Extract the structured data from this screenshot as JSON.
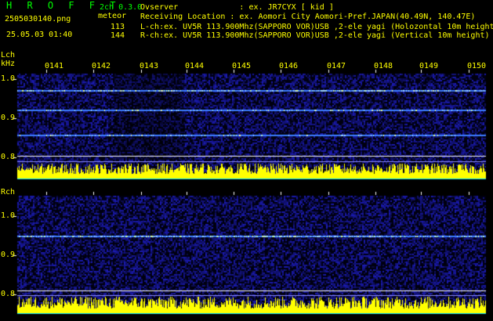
{
  "header": {
    "app_logo": "H R O F F T",
    "channel_mode": "2ch 0.3.0",
    "file_name": "2505030140.png",
    "datetime": "25.05.03 01:40",
    "meteor_label": "meteor",
    "lch_count": "113",
    "rch_count": "144",
    "observer_line": "Ovserver             : ex. JR7CYX [ kid ]",
    "location_line": "Receiving Location : ex. Aomori City Aomori-Pref.JAPAN(40.49N, 140.47E)",
    "lch_line": "L-ch:ex. UV5R 113.900Mhz(SAPPORO VOR)USB ,2-ele yagi (Holozontal 10m height)",
    "rch_line": "R-ch:ex. UV5R 113.900Mhz(SAPPORO VOR)USB ,2-ele yagi (Vertical 10m height)"
  },
  "colors": {
    "logo": "#00ff00",
    "text": "#ffff00",
    "axis": "#ffffff",
    "signal": "#ffff00",
    "signal_base": "#00ffff",
    "background_noise": "#1a1a8c"
  },
  "time_labels": [
    "0141",
    "0142",
    "0143",
    "0144",
    "0145",
    "0146",
    "0147",
    "0148",
    "0149",
    "0150"
  ],
  "left_panel": {
    "channel_label": "Lch",
    "unit_label": "kHz",
    "y_ticks": [
      "1.0",
      "0.9",
      "0.8"
    ]
  },
  "right_panel": {
    "channel_label": "Rch",
    "y_ticks": [
      "1.0",
      "0.9",
      "0.8"
    ]
  }
}
